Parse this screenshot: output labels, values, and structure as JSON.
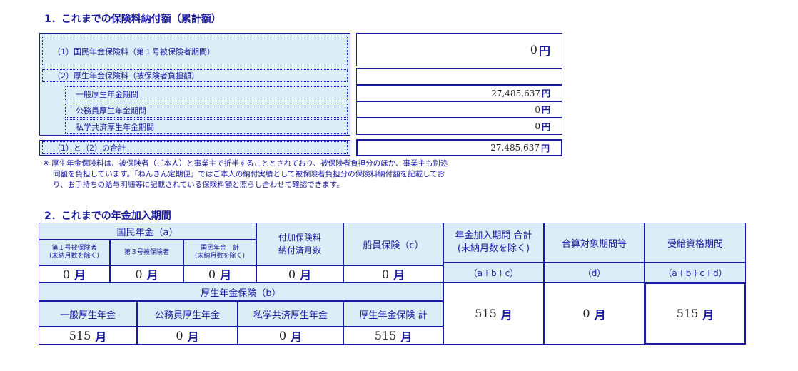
{
  "section1": {
    "title": "1．これまでの保険料納付額（累計額）",
    "row1_label": "（1）国民年金保険料（第１号被保険者期間）",
    "row1_value": "0",
    "row2_label": "（2）厚生年金保険料（被保険者負担額）",
    "sub_rows": [
      {
        "label": "一般厚生年金期間",
        "value": "27,485,637"
      },
      {
        "label": "公務員厚生年金期間",
        "value": "0"
      },
      {
        "label": "私学共済厚生年金期間",
        "value": "0"
      }
    ],
    "total_label": "（1）と（2）の合計",
    "total_value": "27,485,637",
    "unit": "円",
    "note_lines": [
      "※ 厚生年金保険料は、被保険者（ご本人）と事業主で折半することとされており、被保険者負担分のほか、事業主も別途",
      "同額を負担しています。「ねんきん定期便」ではご本人の納付実績として被保険者負担分の保険料納付額を記載してお",
      "り、お手持ちの給与明細等に記載されている保険料額と照らし合わせて確認できます。"
    ]
  },
  "section2": {
    "title": "2．これまでの年金加入期間",
    "unit": "月",
    "kokumin_header": "国民年金（a）",
    "kokumin_cols": [
      {
        "label1": "第１号被保険者",
        "label2": "(未納月数を除く)",
        "value": "0"
      },
      {
        "label1": "第３号被保険者",
        "label2": "",
        "value": "0"
      },
      {
        "label1": "国民年金　計",
        "label2": "(未納月数を除く)",
        "value": "0"
      }
    ],
    "fuka_label1": "付加保険料",
    "fuka_label2": "納付済月数",
    "fuka_value": "0",
    "senin_label": "船員保険（c）",
    "senin_value": "0",
    "kosei_header": "厚生年金保険（b）",
    "kosei_cols": [
      {
        "label": "一般厚生年金",
        "value": "515"
      },
      {
        "label": "公務員厚生年金",
        "value": "0"
      },
      {
        "label": "私学共済厚生年金",
        "value": "0"
      },
      {
        "label": "厚生年金保険 計",
        "value": "515"
      }
    ],
    "total_label1": "年金加入期間 合計",
    "total_label2": "(未納月数を除く)",
    "total_formula": "（a＋b＋c）",
    "total_value": "515",
    "gassan_label": "合算対象期間等",
    "gassan_formula": "（d）",
    "gassan_value": "0",
    "jukyu_label": "受給資格期間",
    "jukyu_formula": "（a＋b＋c＋d）",
    "jukyu_value": "515"
  }
}
